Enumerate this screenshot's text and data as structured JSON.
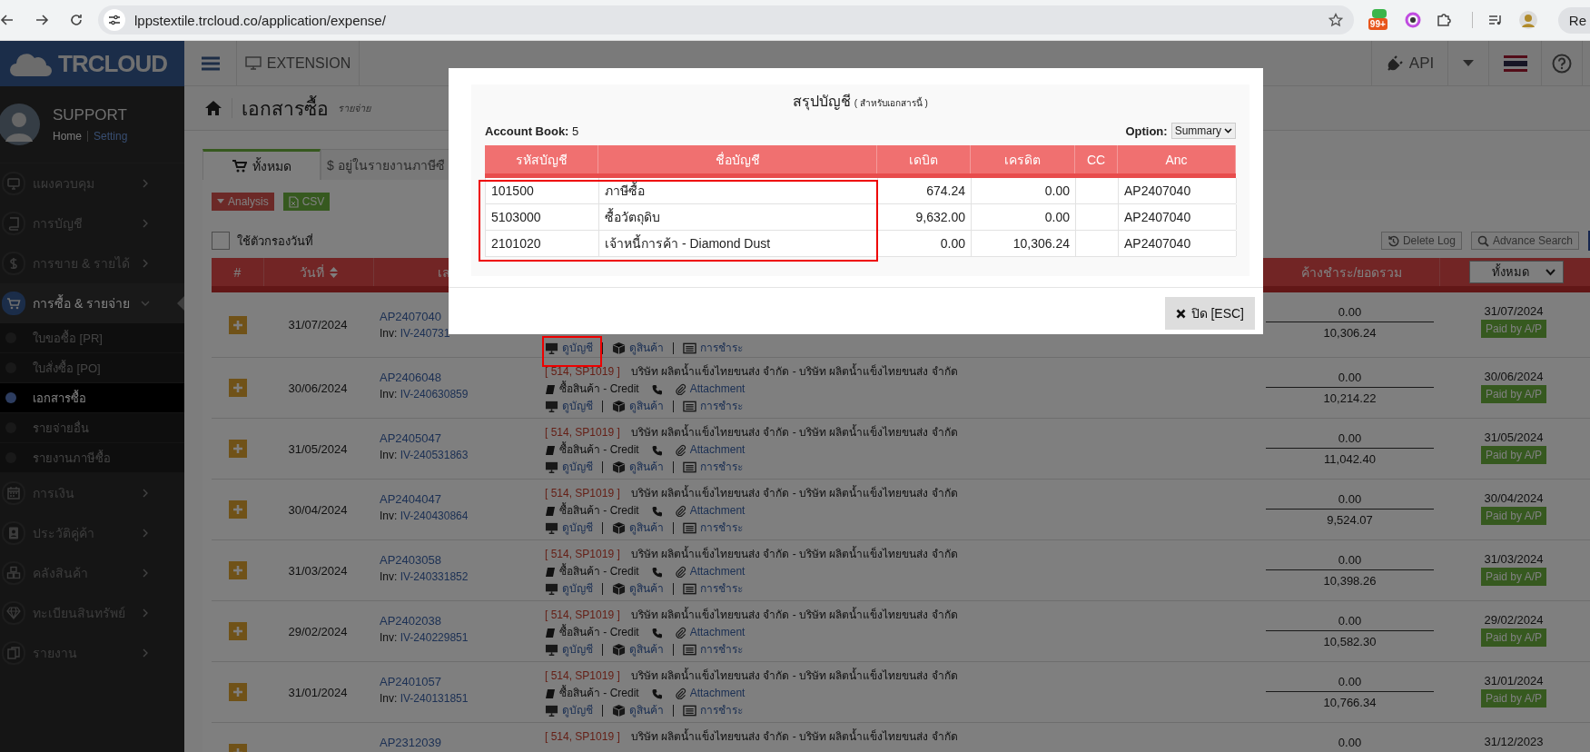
{
  "browser": {
    "url": "lppstextile.trcloud.co/application/expense/",
    "badge": "99+",
    "profile_label": "Re"
  },
  "header": {
    "logo": "TRCLOUD",
    "extension": "EXTENSION",
    "api": "API"
  },
  "user": {
    "name": "SUPPORT",
    "links": [
      "Home",
      "Setting"
    ]
  },
  "sidebar": {
    "items": [
      {
        "label": "แผงควบคุม",
        "expanded": false,
        "selected": false
      },
      {
        "label": "การบัญชี",
        "expanded": false,
        "selected": false
      },
      {
        "label": "การขาย & รายได้",
        "expanded": false,
        "selected": false
      },
      {
        "label": "การซื้อ & รายจ่าย",
        "expanded": true,
        "selected": true,
        "children": [
          {
            "label": "ใบขอซื้อ [PR]",
            "selected": false
          },
          {
            "label": "ใบสั่งซื้อ [PO]",
            "selected": false
          },
          {
            "label": "เอกสารซื้อ",
            "selected": true
          },
          {
            "label": "รายจ่ายอื่น",
            "selected": false
          },
          {
            "label": "รายงานภาษีซื้อ",
            "selected": false
          }
        ]
      },
      {
        "label": "การเงิน",
        "expanded": false,
        "selected": false
      },
      {
        "label": "ประวัติคู่ค้า",
        "expanded": false,
        "selected": false
      },
      {
        "label": "คลังสินค้า",
        "expanded": false,
        "selected": false
      },
      {
        "label": "ทะเบียนสินทรัพย์",
        "expanded": false,
        "selected": false
      },
      {
        "label": "รายงาน",
        "expanded": false,
        "selected": false
      }
    ]
  },
  "page": {
    "title": "เอกสารซื้อ",
    "subtitle": "รายจ่าย",
    "tabs": [
      {
        "label": "ทั้งหมด",
        "selected": true
      },
      {
        "label": "$ อยู่ในรายงานภาษีซื",
        "selected": false
      }
    ],
    "analysis": "Analysis",
    "csv": "CSV",
    "date_filter": {
      "label": "ใช้ตัวกรองวันที่",
      "checked": false
    },
    "delete_log": "Delete Log",
    "advance_search": "Advance Search"
  },
  "table": {
    "columns": [
      "#",
      "วันที่",
      "เล",
      "ค้างชำระ/ยอดรวม"
    ],
    "status_filter": "ทั้งหมด",
    "rows": [
      {
        "date": "31/07/2024",
        "doc_no": "AP2407040",
        "invoice_label": "Inv:",
        "invoice": "IV-240731",
        "links": [
          "ดูบัญชี",
          "ดูสินค้า",
          "การชำระ"
        ],
        "highlighted": true,
        "outstanding": "0.00",
        "total": "10,306.24",
        "status_date": "31/07/2024",
        "status": "Paid by A/P"
      },
      {
        "date": "30/06/2024",
        "doc_no": "AP2406048",
        "invoice_label": "Inv:",
        "invoice": "IV-240630859",
        "code": "[ 514, SP1019 ]",
        "party": "บริษัท ผลิตน้ำแข็งไทยขนส่ง จำกัด - บริษัท ผลิตน้ำแข็งไทยขนส่ง จำกัด",
        "type": "ซื้อสินค้า - Credit",
        "attachment": "Attachment",
        "links": [
          "ดูบัญชี",
          "ดูสินค้า",
          "การชำระ"
        ],
        "highlighted": false,
        "outstanding": "0.00",
        "total": "10,214.22",
        "status_date": "30/06/2024",
        "status": "Paid by A/P"
      },
      {
        "date": "31/05/2024",
        "doc_no": "AP2405047",
        "invoice_label": "Inv:",
        "invoice": "IV-240531863",
        "code": "[ 514, SP1019 ]",
        "party": "บริษัท ผลิตน้ำแข็งไทยขนส่ง จำกัด - บริษัท ผลิตน้ำแข็งไทยขนส่ง จำกัด",
        "type": "ซื้อสินค้า - Credit",
        "attachment": "Attachment",
        "links": [
          "ดูบัญชี",
          "ดูสินค้า",
          "การชำระ"
        ],
        "highlighted": false,
        "outstanding": "0.00",
        "total": "11,042.40",
        "status_date": "31/05/2024",
        "status": "Paid by A/P"
      },
      {
        "date": "30/04/2024",
        "doc_no": "AP2404047",
        "invoice_label": "Inv:",
        "invoice": "IV-240430864",
        "code": "[ 514, SP1019 ]",
        "party": "บริษัท ผลิตน้ำแข็งไทยขนส่ง จำกัด - บริษัท ผลิตน้ำแข็งไทยขนส่ง จำกัด",
        "type": "ซื้อสินค้า - Credit",
        "attachment": "Attachment",
        "links": [
          "ดูบัญชี",
          "ดูสินค้า",
          "การชำระ"
        ],
        "highlighted": false,
        "outstanding": "0.00",
        "total": "9,524.07",
        "status_date": "30/04/2024",
        "status": "Paid by A/P"
      },
      {
        "date": "31/03/2024",
        "doc_no": "AP2403058",
        "invoice_label": "Inv:",
        "invoice": "IV-240331852",
        "code": "[ 514, SP1019 ]",
        "party": "บริษัท ผลิตน้ำแข็งไทยขนส่ง จำกัด - บริษัท ผลิตน้ำแข็งไทยขนส่ง จำกัด",
        "type": "ซื้อสินค้า - Credit",
        "attachment": "Attachment",
        "links": [
          "ดูบัญชี",
          "ดูสินค้า",
          "การชำระ"
        ],
        "highlighted": false,
        "outstanding": "0.00",
        "total": "10,398.26",
        "status_date": "31/03/2024",
        "status": "Paid by A/P"
      },
      {
        "date": "29/02/2024",
        "doc_no": "AP2402038",
        "invoice_label": "Inv:",
        "invoice": "IV-240229851",
        "code": "[ 514, SP1019 ]",
        "party": "บริษัท ผลิตน้ำแข็งไทยขนส่ง จำกัด - บริษัท ผลิตน้ำแข็งไทยขนส่ง จำกัด",
        "type": "ซื้อสินค้า - Credit",
        "attachment": "Attachment",
        "links": [
          "ดูบัญชี",
          "ดูสินค้า",
          "การชำระ"
        ],
        "highlighted": false,
        "outstanding": "0.00",
        "total": "10,582.30",
        "status_date": "29/02/2024",
        "status": "Paid by A/P"
      },
      {
        "date": "31/01/2024",
        "doc_no": "AP2401057",
        "invoice_label": "Inv:",
        "invoice": "IV-240131851",
        "code": "[ 514, SP1019 ]",
        "party": "บริษัท ผลิตน้ำแข็งไทยขนส่ง จำกัด - บริษัท ผลิตน้ำแข็งไทยขนส่ง จำกัด",
        "type": "ซื้อสินค้า - Credit",
        "attachment": "Attachment",
        "links": [
          "ดูบัญชี",
          "ดูสินค้า",
          "การชำระ"
        ],
        "highlighted": false,
        "outstanding": "0.00",
        "total": "10,766.34",
        "status_date": "31/01/2024",
        "status": "Paid by A/P"
      },
      {
        "doc_no": "AP2312039",
        "code": "[ 514, SP1019 ]",
        "party": "บริษัท ผลิตน้ำแข็งไทยขนส่ง จำกัด - บริษัท ผลิตน้ำแข็งไทยขนส่ง จำกัด",
        "highlighted": false,
        "outstanding": "0.00",
        "status_date": "31/12/2023"
      }
    ]
  },
  "modal": {
    "title": "สรุปบัญชี",
    "title_note": "( สำหรับเอกสารนี้ )",
    "account_book": "**Account Book:** 5",
    "option_label": "Option:",
    "option_value": "Summary",
    "columns": [
      "รหัสบัญชี",
      "ชื่อบัญชี",
      "เดบิต",
      "เครดิต",
      "CC",
      "Anc"
    ],
    "highlight_box": true,
    "rows": [
      {
        "code": "101500",
        "name": "ภาษีซื้อ",
        "debit": "674.24",
        "credit": "0.00",
        "anc": "AP2407040"
      },
      {
        "code": "5103000",
        "name": "ซื้อวัตถุดิบ",
        "debit": "9,632.00",
        "credit": "0.00",
        "anc": "AP2407040"
      },
      {
        "code": "2101020",
        "name": "เจ้าหนี้การค้า - Diamond Dust",
        "debit": "0.00",
        "credit": "10,306.24",
        "anc": "AP2407040"
      }
    ],
    "close": "ปิด [ESC]"
  }
}
